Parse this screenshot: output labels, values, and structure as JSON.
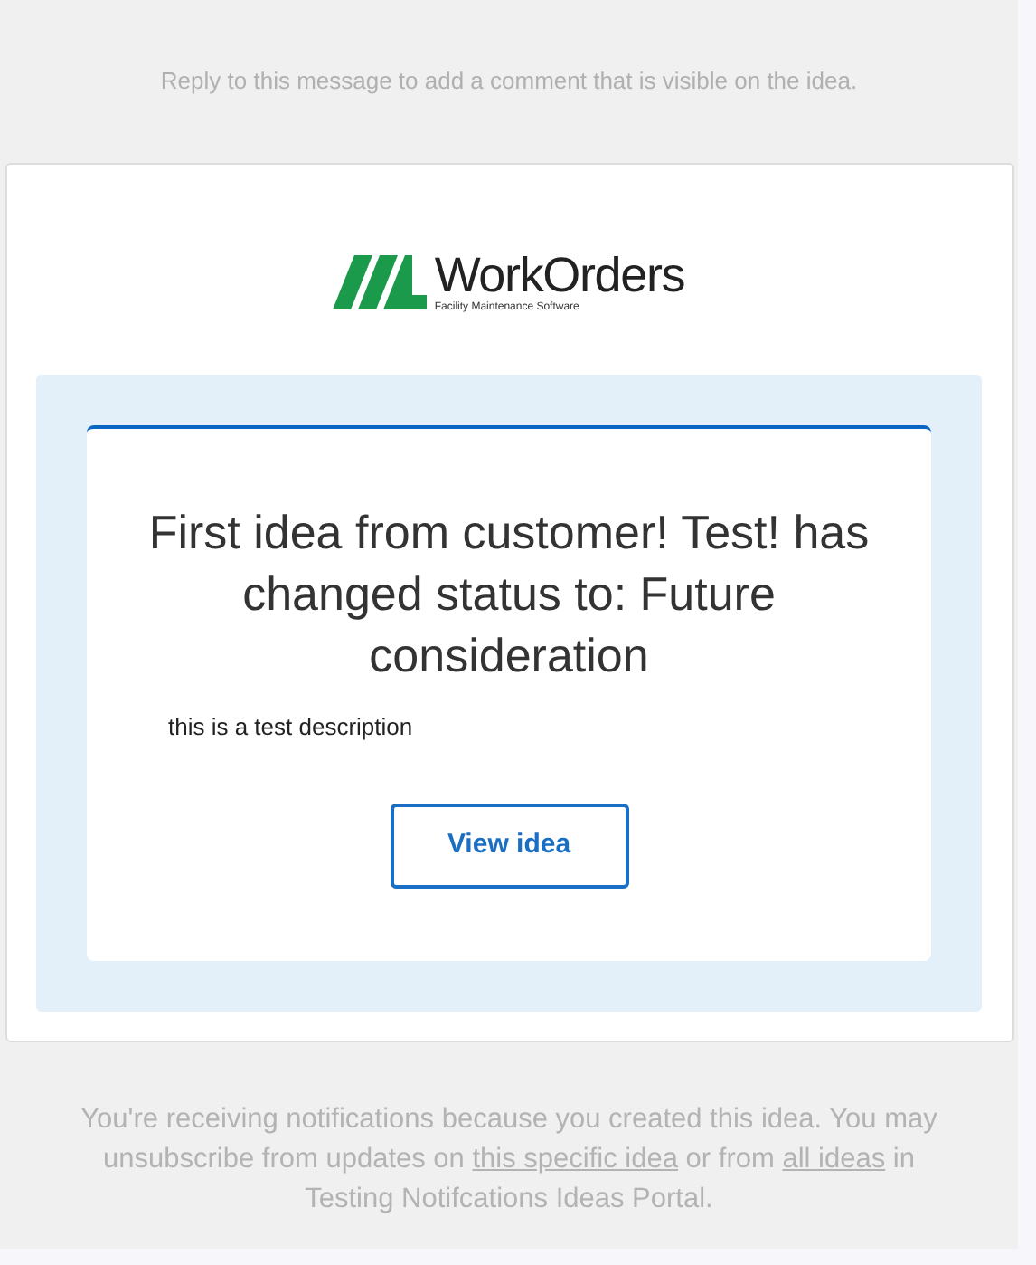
{
  "reply_note": "Reply to this message to add a comment that is visible on the idea.",
  "logo": {
    "name": "WorkOrders",
    "tagline": "Facility Maintenance Software"
  },
  "notification": {
    "title": "First idea from customer! Test! has changed status to: Future consideration",
    "description": "this is a test description",
    "button": "View idea"
  },
  "footer": {
    "before": "You're receiving notifications because you created this idea. You may unsubscribe from updates on",
    "link_1": "this specific idea",
    "middle": "or from",
    "link_2": "all ideas",
    "after": "in Testing Notifcations Ideas Portal."
  }
}
